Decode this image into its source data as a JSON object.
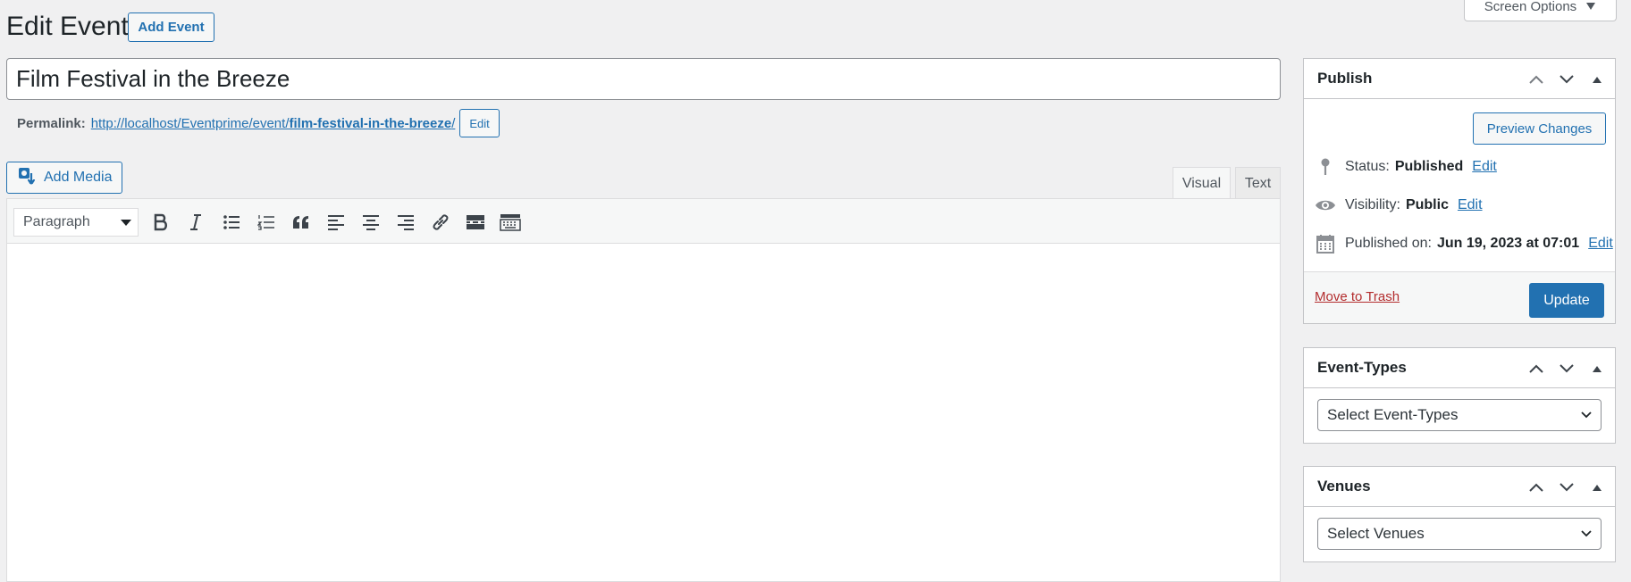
{
  "header": {
    "title": "Edit Event",
    "add_button": "Add Event",
    "screen_options": "Screen Options"
  },
  "post": {
    "title": "Film Festival in the Breeze",
    "permalink_label": "Permalink:",
    "permalink_base": "http://localhost/Eventprime/event/",
    "permalink_slug": "film-festival-in-the-breeze",
    "permalink_trailing": "/",
    "permalink_edit": "Edit"
  },
  "editor": {
    "add_media": "Add Media",
    "tabs": {
      "visual": "Visual",
      "text": "Text"
    },
    "format_select": "Paragraph",
    "toolbar_icons": [
      "bold-icon",
      "italic-icon",
      "bullet-list-icon",
      "numbered-list-icon",
      "blockquote-icon",
      "align-left-icon",
      "align-center-icon",
      "align-right-icon",
      "link-icon",
      "read-more-icon",
      "toolbar-toggle-icon"
    ]
  },
  "publish": {
    "title": "Publish",
    "preview_button": "Preview Changes",
    "status_label": "Status:",
    "status_value": "Published",
    "visibility_label": "Visibility:",
    "visibility_value": "Public",
    "published_label": "Published on:",
    "published_value": "Jun 19, 2023 at 07:01",
    "edit_link": "Edit",
    "trash_link": "Move to Trash",
    "update_button": "Update"
  },
  "event_types": {
    "title": "Event-Types",
    "select": "Select Event-Types"
  },
  "venues": {
    "title": "Venues",
    "select": "Select Venues"
  },
  "colors": {
    "accent": "#2271b1",
    "trash": "#b32d2e",
    "background": "#f0f0f1"
  }
}
